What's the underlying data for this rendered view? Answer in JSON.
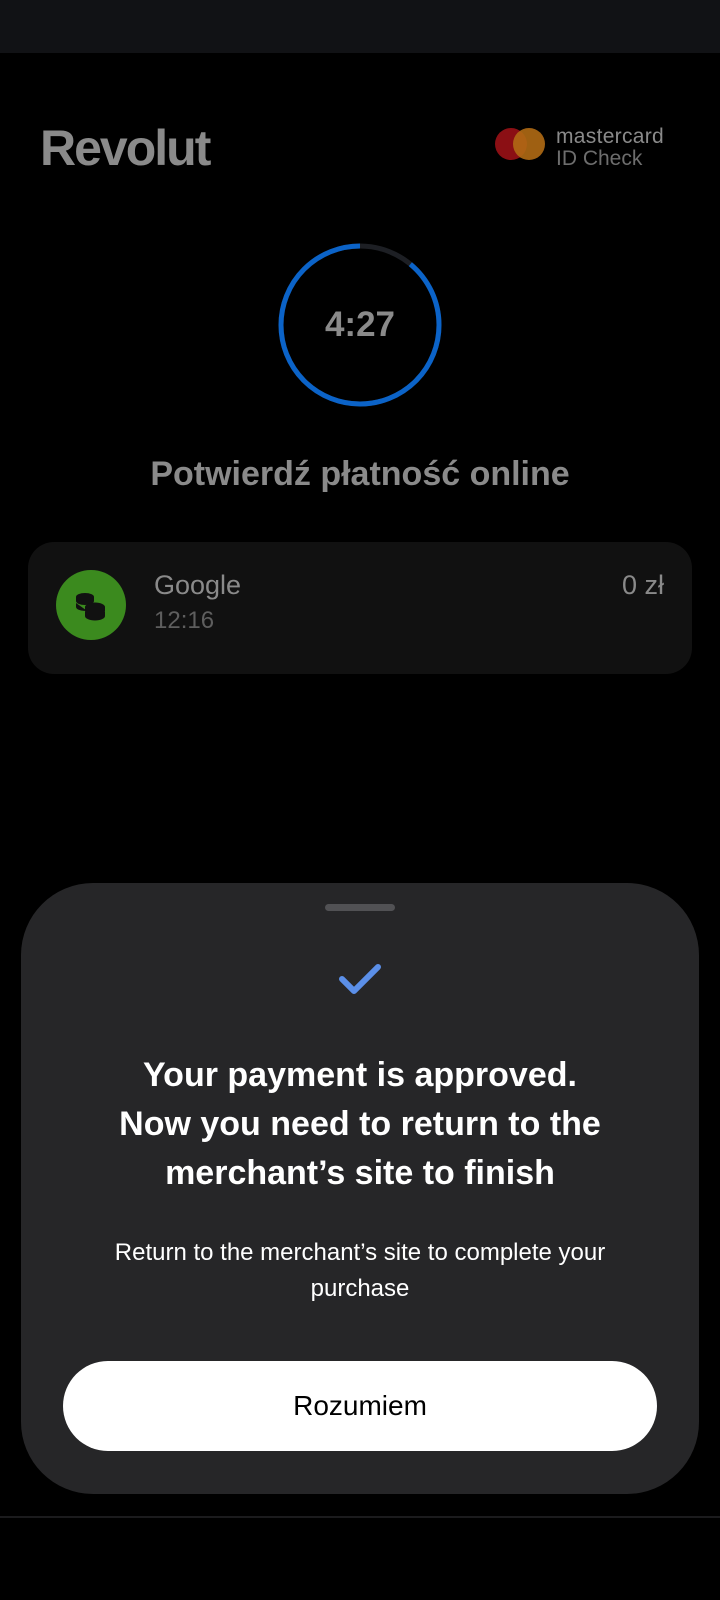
{
  "brand": {
    "logo_text": "Revolut"
  },
  "badge": {
    "line1": "mastercard",
    "line2": "ID Check",
    "colors": {
      "red": "#8b0f14",
      "orange": "#b06a14"
    }
  },
  "timer": {
    "value": "4:27",
    "progress": 0.89,
    "accent": "#0b63c8"
  },
  "headline": "Potwierdź płatność online",
  "transaction": {
    "icon": "coins-icon",
    "merchant": "Google",
    "time": "12:16",
    "amount": "0 zł",
    "icon_color": "#3b8a1e"
  },
  "sheet": {
    "check_icon": "checkmark-icon",
    "title_lines": [
      "Your payment is approved.",
      "Now you need to return to the",
      "merchant’s site to finish"
    ],
    "subtitle_lines": [
      "Return to the merchant’s site to complete your",
      "purchase"
    ],
    "button_label": "Rozumiem"
  }
}
